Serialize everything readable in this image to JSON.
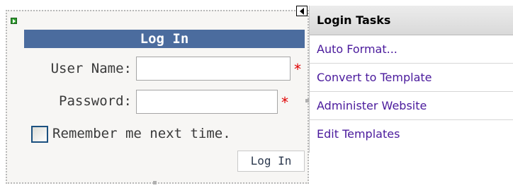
{
  "login_control": {
    "title": "Log In",
    "username_label": "User Name:",
    "password_label": "Password:",
    "username_value": "",
    "password_value": "",
    "required_marker": "*",
    "remember_label": "Remember me next time.",
    "remember_checked": false,
    "submit_label": "Log In"
  },
  "tasks_panel": {
    "header": "Login Tasks",
    "items": [
      {
        "label": "Auto Format..."
      },
      {
        "label": "Convert to Template"
      },
      {
        "label": "Administer Website"
      },
      {
        "label": "Edit Templates"
      }
    ]
  },
  "colors": {
    "title_bar": "#4b6c9e",
    "required": "#e00000",
    "task_link": "#4a1a9c"
  },
  "icons": {
    "control_glyph": "green-arrow-icon",
    "smart_tag": "smart-tag-arrow-icon"
  }
}
